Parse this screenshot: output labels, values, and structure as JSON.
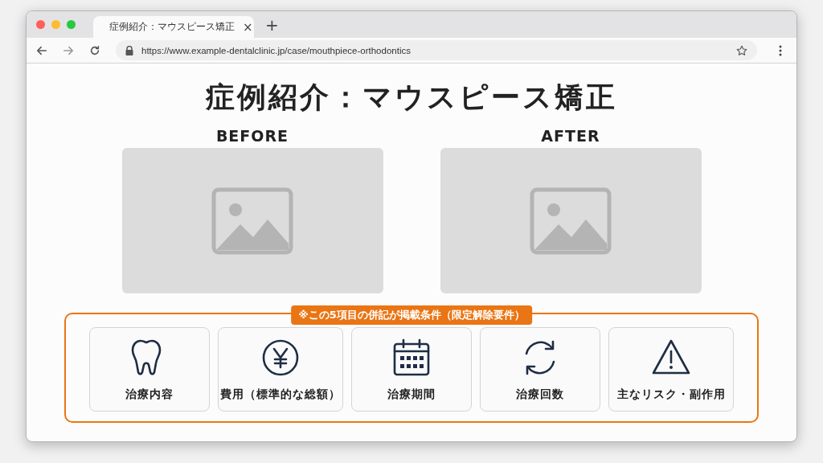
{
  "window": {
    "tab": {
      "title": "症例紹介：マウスピース矯正",
      "close": "×",
      "selected": true
    },
    "new_tab": "+",
    "address_bar": {
      "url": "https://www.example-dentalclinic.jp/case/mouthpiece-orthodontics"
    }
  },
  "page": {
    "title": "症例紹介：マウスピース矯正",
    "comparison": [
      {
        "label": "BEFORE",
        "kind": "placeholder"
      },
      {
        "label": "AFTER",
        "kind": "placeholder"
      }
    ],
    "requirements": {
      "badge": "※この5項目の併記が掲載条件（限定解除要件）",
      "items": [
        {
          "kind": "tooth",
          "label": "治療内容"
        },
        {
          "kind": "yen",
          "label": "費用（標準的な総額）"
        },
        {
          "kind": "calendar",
          "label": "治療期間"
        },
        {
          "kind": "refresh",
          "label": "治療回数"
        },
        {
          "kind": "warning",
          "label": "主なリスク・副作用"
        }
      ]
    }
  }
}
